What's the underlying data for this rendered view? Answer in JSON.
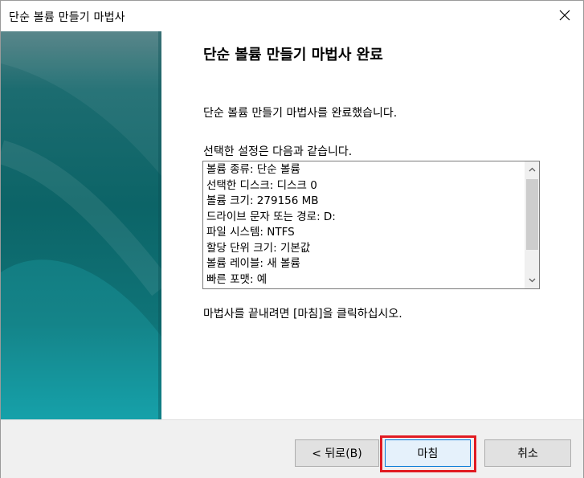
{
  "window": {
    "title": "단순 볼륨 만들기 마법사"
  },
  "content": {
    "heading": "단순 볼륨 만들기 마법사 완료",
    "completed_text": "단순 볼륨 만들기 마법사를 완료했습니다.",
    "settings_intro": "선택한 설정은 다음과 같습니다.",
    "settings": [
      "볼륨 종류: 단순 볼륨",
      "선택한 디스크: 디스크 0",
      "볼륨 크기: 279156 MB",
      "드라이브 문자 또는 경로: D:",
      "파일 시스템: NTFS",
      "할당 단위 크기: 기본값",
      "볼륨 레이블: 새 볼륨",
      "빠른 포맷: 예"
    ],
    "close_instruction": "마법사를 끝내려면 [마침]을 클릭하십시오."
  },
  "buttons": {
    "back": "< 뒤로(B)",
    "finish": "마침",
    "cancel": "취소"
  },
  "colors": {
    "banner_top": "#4f7f83",
    "banner_bottom": "#129ba4",
    "highlight": "#e11b22",
    "default_button_border": "#0078d7"
  },
  "icons": {
    "close": "close-icon",
    "scroll_up": "chevron-up-icon",
    "scroll_down": "chevron-down-icon"
  }
}
